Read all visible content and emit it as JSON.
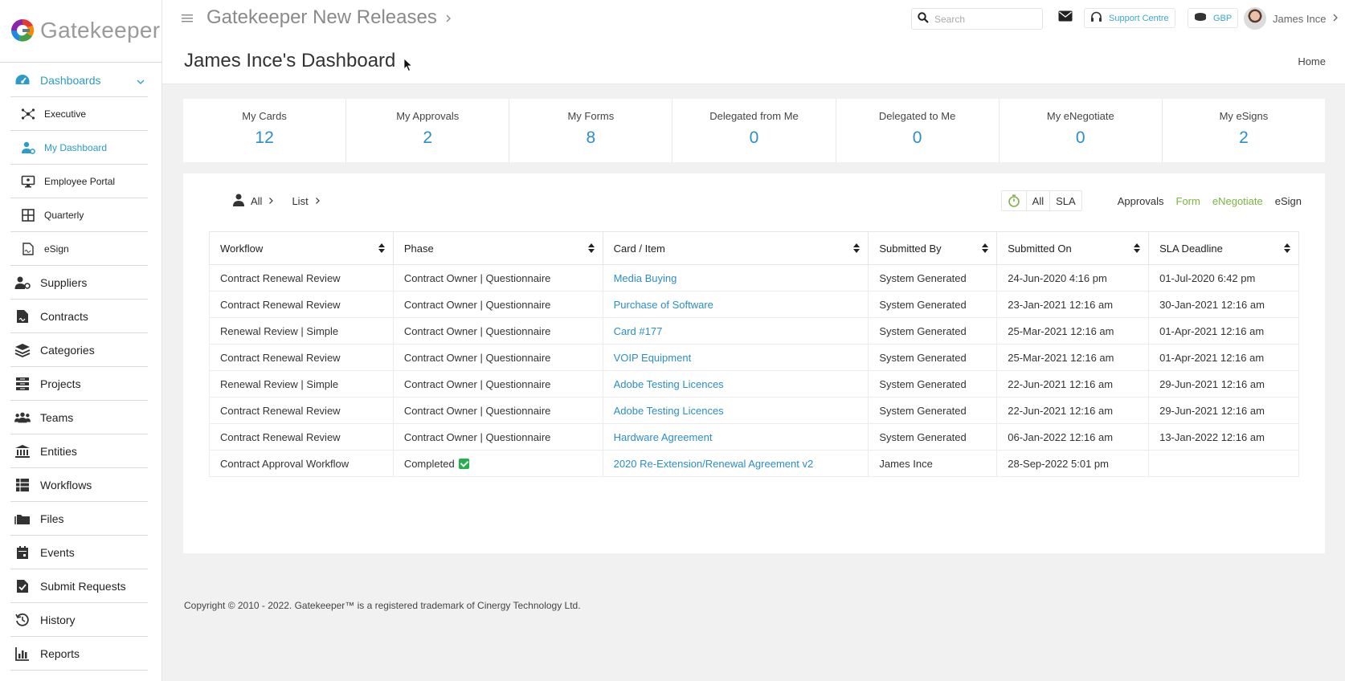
{
  "brand": {
    "name": "Gatekeeper"
  },
  "header": {
    "app_title": "Gatekeeper New Releases",
    "page_title": "James Ince's Dashboard",
    "home_link": "Home",
    "search_placeholder": "Search",
    "support_label": "Support Centre",
    "currency_label": "GBP",
    "user_name": "James Ince"
  },
  "sidebar": {
    "group": {
      "label": "Dashboards",
      "icon": "gauge-icon"
    },
    "sub_items": [
      {
        "label": "Executive",
        "icon": "network-icon"
      },
      {
        "label": "My Dashboard",
        "icon": "user-cog-icon"
      },
      {
        "label": "Employee Portal",
        "icon": "monitor-icon"
      },
      {
        "label": "Quarterly",
        "icon": "grid-icon"
      },
      {
        "label": "eSign",
        "icon": "signature-icon"
      }
    ],
    "items": [
      {
        "label": "Suppliers",
        "icon": "supplier-icon"
      },
      {
        "label": "Contracts",
        "icon": "contract-icon"
      },
      {
        "label": "Categories",
        "icon": "layers-icon"
      },
      {
        "label": "Projects",
        "icon": "projects-icon"
      },
      {
        "label": "Teams",
        "icon": "teams-icon"
      },
      {
        "label": "Entities",
        "icon": "building-icon"
      },
      {
        "label": "Workflows",
        "icon": "workflow-icon"
      },
      {
        "label": "Files",
        "icon": "folder-icon"
      },
      {
        "label": "Events",
        "icon": "calendar-icon"
      },
      {
        "label": "Submit Requests",
        "icon": "clipboard-check-icon"
      },
      {
        "label": "History",
        "icon": "history-icon"
      },
      {
        "label": "Reports",
        "icon": "bar-chart-icon"
      }
    ]
  },
  "stats": [
    {
      "label": "My Cards",
      "value": "12"
    },
    {
      "label": "My Approvals",
      "value": "2"
    },
    {
      "label": "My Forms",
      "value": "8"
    },
    {
      "label": "Delegated from Me",
      "value": "0"
    },
    {
      "label": "Delegated to Me",
      "value": "0"
    },
    {
      "label": "My eNegotiate",
      "value": "0"
    },
    {
      "label": "My eSigns",
      "value": "2"
    }
  ],
  "filters": {
    "scope": "All",
    "view": "List",
    "sla_all": "All",
    "sla_sla": "SLA",
    "types": [
      {
        "label": "Approvals",
        "color": "#333333"
      },
      {
        "label": "Form",
        "color": "#7cb342"
      },
      {
        "label": "eNegotiate",
        "color": "#7cb342"
      },
      {
        "label": "eSign",
        "color": "#333333"
      }
    ]
  },
  "table": {
    "columns": [
      "Workflow",
      "Phase",
      "Card / Item",
      "Submitted By",
      "Submitted On",
      "SLA Deadline"
    ],
    "rows": [
      [
        "Contract Renewal Review",
        "Contract Owner | Questionnaire",
        "Media Buying",
        "System Generated",
        "24-Jun-2020 4:16 pm",
        "01-Jul-2020 6:42 pm"
      ],
      [
        "Contract Renewal Review",
        "Contract Owner | Questionnaire",
        "Purchase of Software",
        "System Generated",
        "23-Jan-2021 12:16 am",
        "30-Jan-2021 12:16 am"
      ],
      [
        "Renewal Review | Simple",
        "Contract Owner | Questionnaire",
        "Card #177",
        "System Generated",
        "25-Mar-2021 12:16 am",
        "01-Apr-2021 12:16 am"
      ],
      [
        "Contract Renewal Review",
        "Contract Owner | Questionnaire",
        "VOIP Equipment",
        "System Generated",
        "25-Mar-2021 12:16 am",
        "01-Apr-2021 12:16 am"
      ],
      [
        "Renewal Review | Simple",
        "Contract Owner | Questionnaire",
        "Adobe Testing Licences",
        "System Generated",
        "22-Jun-2021 12:16 am",
        "29-Jun-2021 12:16 am"
      ],
      [
        "Contract Renewal Review",
        "Contract Owner | Questionnaire",
        "Adobe Testing Licences",
        "System Generated",
        "22-Jun-2021 12:16 am",
        "29-Jun-2021 12:16 am"
      ],
      [
        "Contract Renewal Review",
        "Contract Owner | Questionnaire",
        "Hardware Agreement",
        "System Generated",
        "06-Jan-2022 12:16 am",
        "13-Jan-2022 12:16 am"
      ],
      [
        "Contract Approval Workflow",
        "Completed",
        "2020 Re-Extension/Renewal Agreement v2",
        "James Ince",
        "28-Sep-2022 5:01 pm",
        ""
      ]
    ],
    "completed_badge_icon": "check-square-icon"
  },
  "footer": {
    "copyright": "Copyright © 2010 - 2022. Gatekeeper™ is a registered trademark of Cinergy Technology Ltd."
  },
  "colors": {
    "accent": "#2b8ec7",
    "green": "#7cb342"
  }
}
